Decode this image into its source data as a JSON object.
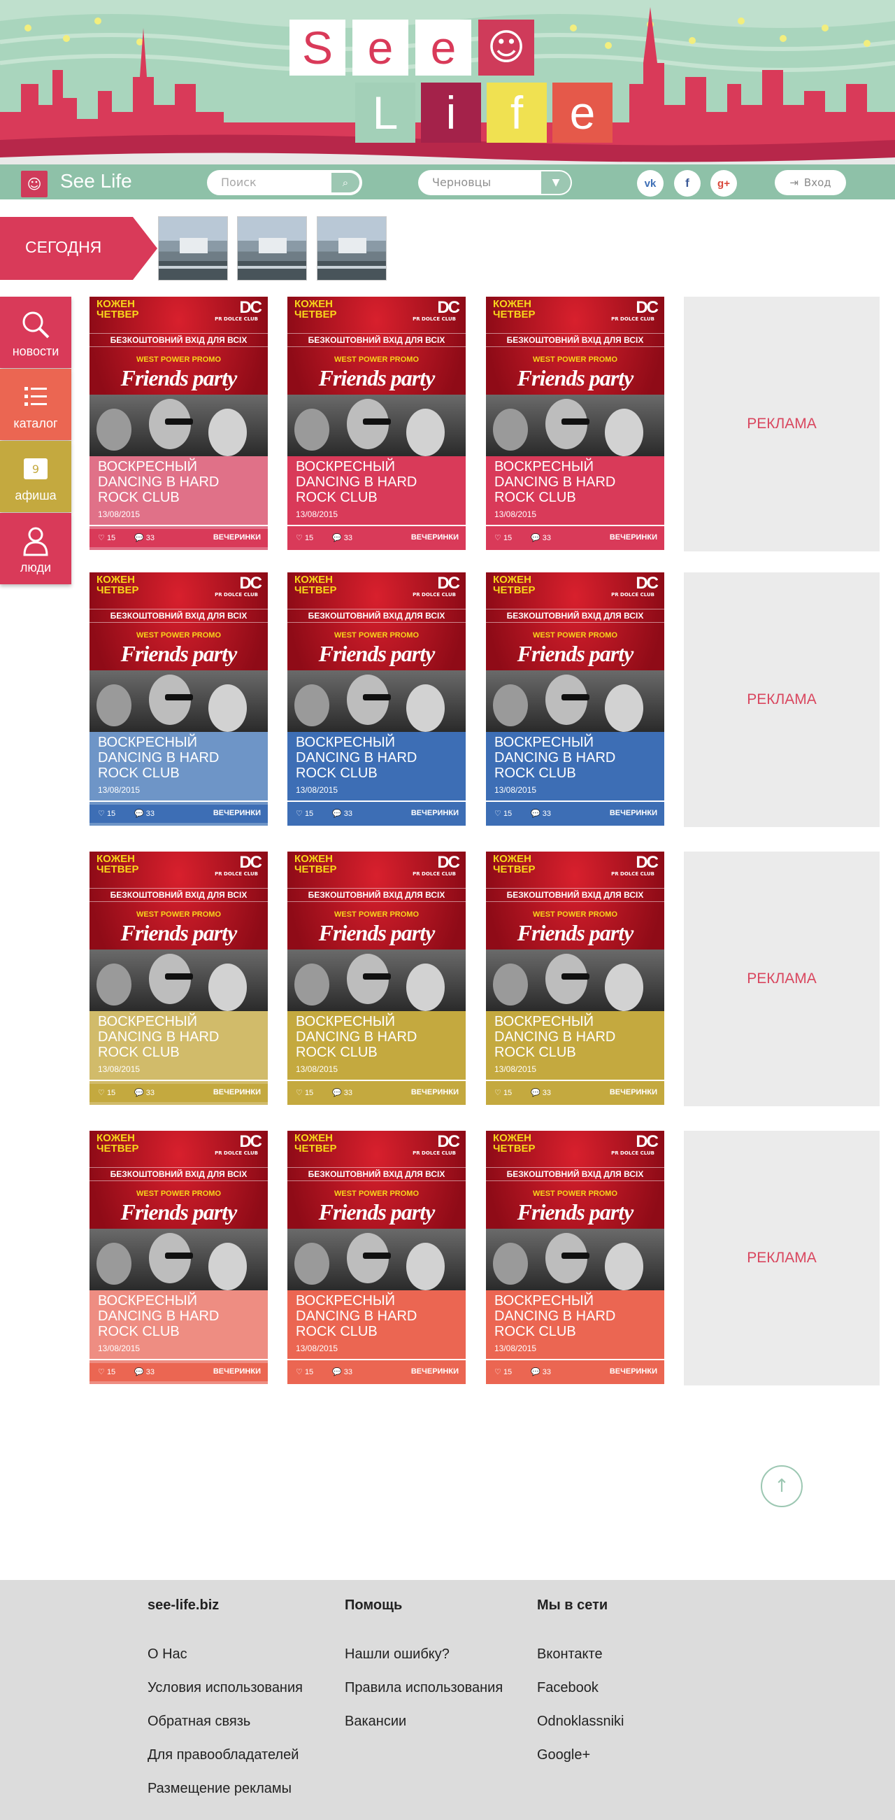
{
  "header": {
    "logo_letters_top": [
      "S",
      "e",
      "e"
    ],
    "logo_letters_bottom": [
      "L",
      "i",
      "f",
      "e"
    ],
    "site_name": "See Life",
    "search_placeholder": "Поиск",
    "city": "Черновцы",
    "social": [
      "vk",
      "f",
      "g+"
    ],
    "login": "Вход"
  },
  "today": {
    "label": "СЕГОДНЯ",
    "thumbs": 3
  },
  "sidebar": [
    {
      "label": "новости",
      "icon": "search-icon",
      "color": "#d93a59"
    },
    {
      "label": "каталог",
      "icon": "list-icon",
      "color": "#eb6652"
    },
    {
      "label": "афиша",
      "icon": "calendar-icon",
      "color": "#c4a93f",
      "calendar_day": "9"
    },
    {
      "label": "люди",
      "icon": "person-icon",
      "color": "#d93a59"
    }
  ],
  "poster": {
    "top_left": "КОЖЕН\nЧЕТВЕР",
    "logo": "DC",
    "club": "PR DOLCE CLUB",
    "free": "БЕЗКОШТОВНИЙ ВХІД ДЛЯ ВСІХ",
    "promo": "WEST POWER PROMO",
    "title": "Friends party"
  },
  "card": {
    "title": "ВОСКРЕСНЫЙ DANCING В HARD ROCK CLUB",
    "date": "13/08/2015",
    "likes": "15",
    "comments": "33",
    "category": "ВЕЧЕРИНКИ"
  },
  "rows": [
    {
      "colors": [
        "#e07188",
        "#d93a59",
        "#d93a59"
      ],
      "bar": [
        "#d93a59",
        "#d93a59",
        "#d93a59"
      ]
    },
    {
      "colors": [
        "#6e95c7",
        "#3d6eb5",
        "#3d6eb5"
      ],
      "bar": [
        "#3d6eb5",
        "#3d6eb5",
        "#3d6eb5"
      ]
    },
    {
      "colors": [
        "#d1bb6a",
        "#c4a93f",
        "#c4a93f"
      ],
      "bar": [
        "#c4a93f",
        "#c4a93f",
        "#c4a93f"
      ]
    },
    {
      "colors": [
        "#ee8d82",
        "#eb6652",
        "#eb6652"
      ],
      "bar": [
        "#eb6652",
        "#eb6652",
        "#eb6652"
      ]
    }
  ],
  "ad_label": "РЕКЛАМА",
  "footer": {
    "col1": {
      "title": "see-life.biz",
      "links": [
        "О Нас",
        "Условия использования",
        "Обратная связь",
        "Для правообладателей",
        "Размещение рекламы"
      ]
    },
    "col2": {
      "title": "Помощь",
      "links": [
        "Нашли ошибку?",
        "Правила использования",
        "Вакансии"
      ]
    },
    "col3": {
      "title": "Мы в сети",
      "links": [
        "Вконтакте",
        "Facebook",
        "Odnoklassniki",
        "Google+"
      ]
    }
  }
}
